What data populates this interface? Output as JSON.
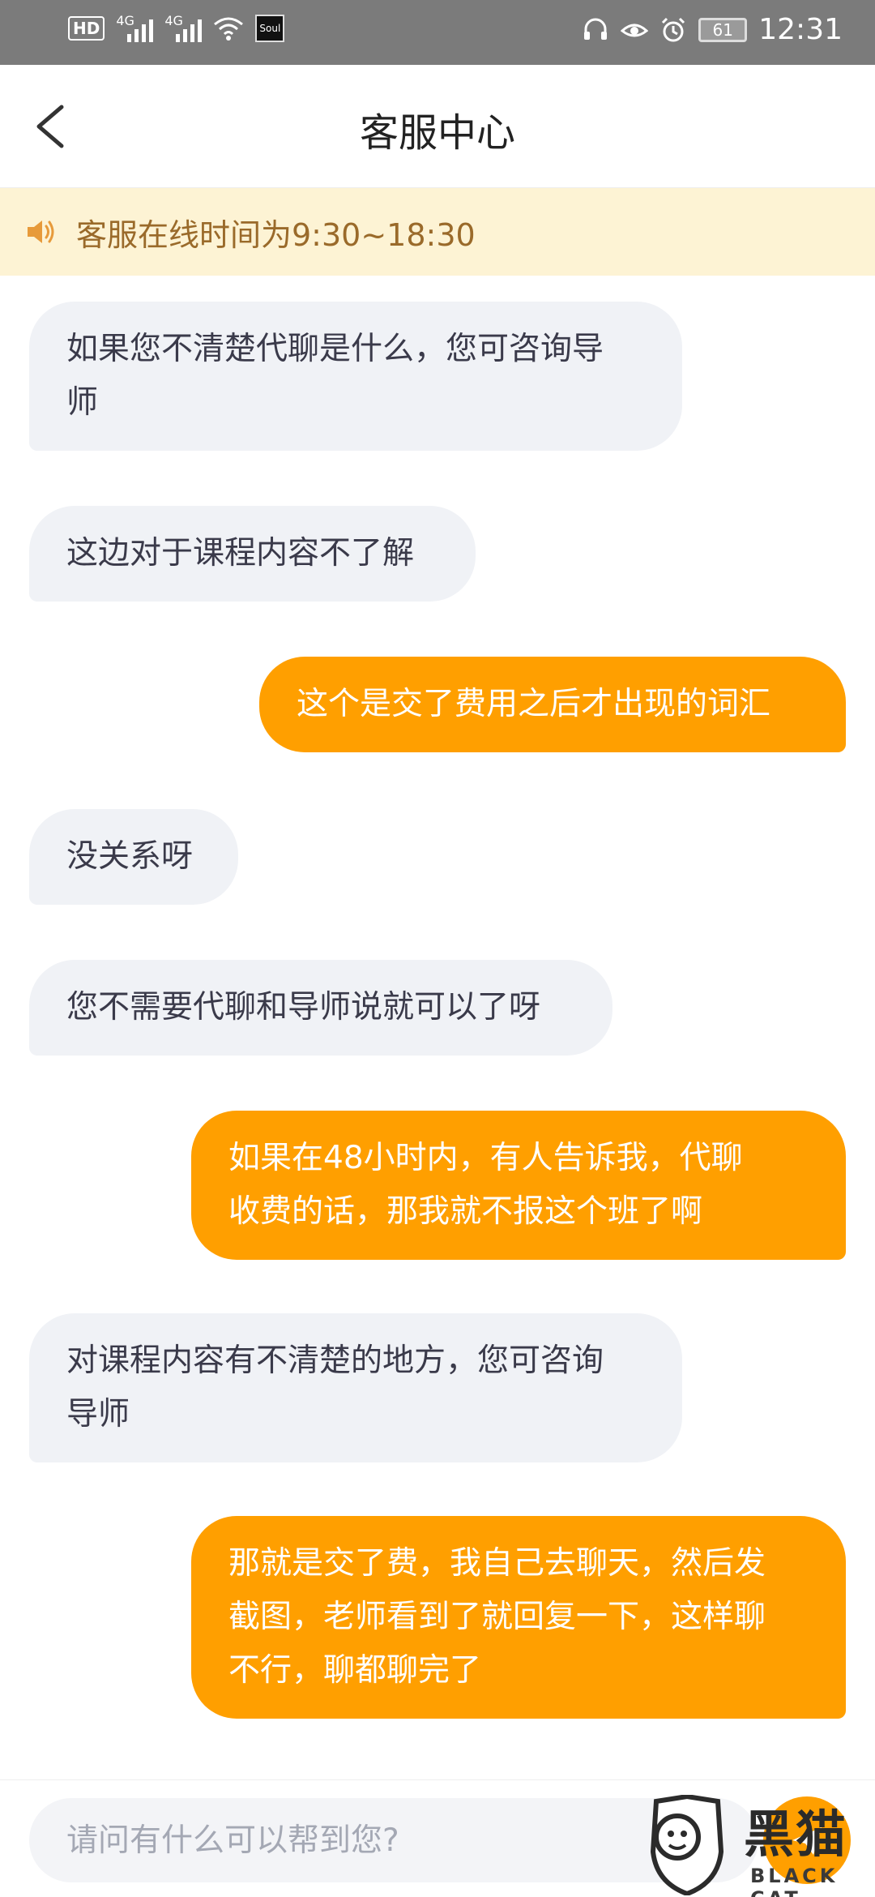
{
  "status_bar": {
    "hd": "HD",
    "network1": "4G",
    "network2": "4G",
    "app_icon_label": "Soul",
    "battery": "61",
    "time": "12:31"
  },
  "header": {
    "title": "客服中心",
    "back_icon": "chevron-left-icon"
  },
  "notice": {
    "icon": "speaker-icon",
    "text": "客服在线时间为9:30~18:30"
  },
  "messages": [
    {
      "side": "in",
      "text": "如果您不清楚代聊是什么，您可咨询导\n师"
    },
    {
      "side": "in",
      "text": "这边对于课程内容不了解"
    },
    {
      "side": "out",
      "text": "这个是交了费用之后才出现的词汇"
    },
    {
      "side": "in",
      "text": "没关系呀"
    },
    {
      "side": "in",
      "text": "您不需要代聊和导师说就可以了呀"
    },
    {
      "side": "out",
      "text": "如果在48小时内，有人告诉我，代聊\n收费的话，那我就不报这个班了啊"
    },
    {
      "side": "in",
      "text": "对课程内容有不清楚的地方，您可咨询\n导师"
    },
    {
      "side": "out",
      "text": "那就是交了费，我自己去聊天，然后发\n截图，老师看到了就回复一下，这样聊\n不行，聊都聊完了"
    }
  ],
  "input": {
    "placeholder": "请问有什么可以帮到您?",
    "value": ""
  },
  "watermark": {
    "text": "黑猫",
    "subtext": "BLACK CAT"
  },
  "colors": {
    "accent": "#ff9f00",
    "incoming_bubble": "#f0f2f6",
    "notice_bg": "#fdf3d4",
    "notice_text": "#9a6a2a"
  }
}
